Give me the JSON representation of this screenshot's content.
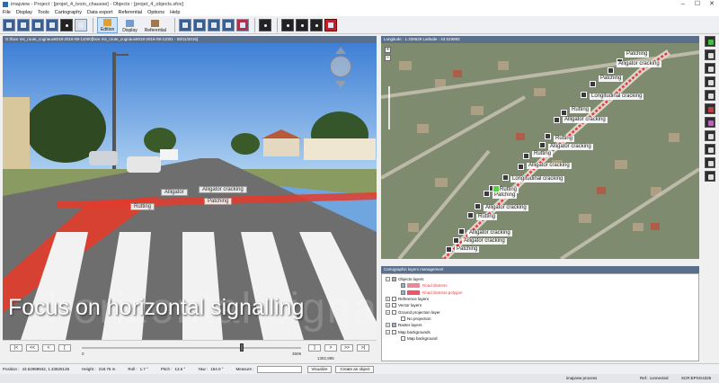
{
  "window": {
    "title": "imajview - Project : [projet_4_tvoin_chausse] - Objects : [projet_4_objects.sfov]",
    "controls": [
      "–",
      "☐",
      "✕"
    ]
  },
  "menu": [
    "File",
    "Display",
    "Tools",
    "Cartography",
    "Data export",
    "Referential",
    "Options",
    "Help"
  ],
  "toolbar": {
    "edition_label": "Edition",
    "display_label": "Display",
    "referential_label": "Referential"
  },
  "video": {
    "header": "G:\\face ms_route_cugnaux6018-2016-08-11000[face ms_route_cugnaux6018-2016-08-11001 - 08/11/2016]",
    "caption": "Focus on horizontal signalling",
    "caption_ghost": "horizontal signalling",
    "labels": {
      "alligator": "Alligator",
      "alligator_cracking": "Alligator cracking",
      "patching": "Patching",
      "rutting": "Rutting"
    }
  },
  "transport": {
    "buttons": [
      "|<",
      "<<",
      "<",
      "[",
      "]",
      ">",
      ">>",
      ">|"
    ],
    "range_start": "0",
    "range_end": "3909",
    "position": 0.73,
    "distance": "1382,886"
  },
  "map": {
    "header": "Longitude : 1.339529 Latitude : 43.529892",
    "tools": [
      "+",
      "−"
    ],
    "labels": [
      "Patching",
      "Alligator cracking",
      "Patching",
      "Longitudinal cracking",
      "Rutting",
      "Alligator cracking",
      "Rutting",
      "Alligator cracking",
      "Rutting",
      "Alligator cracking",
      "Longitudinal cracking",
      "Rutting",
      "Patching",
      "Alligator cracking",
      "Rutting",
      "Alligator cracking",
      "Alligator cracking",
      "Patching"
    ]
  },
  "layers": {
    "header": "Cartographic layers management",
    "rows": [
      {
        "text": "Objects layers",
        "indent": 0,
        "exp": "−",
        "checked": true,
        "red": false
      },
      {
        "text": "Road distress",
        "indent": 1,
        "exp": "",
        "checked": true,
        "red": true,
        "swatch": "#ee8899"
      },
      {
        "text": "Road distress polygon",
        "indent": 1,
        "exp": "",
        "checked": true,
        "red": true,
        "swatch": "#ee5566"
      },
      {
        "text": "Reference layers",
        "indent": 0,
        "exp": "+",
        "checked": false,
        "red": false
      },
      {
        "text": "Vector layers",
        "indent": 0,
        "exp": "+",
        "checked": false,
        "red": false
      },
      {
        "text": "Ground projection layer",
        "indent": 0,
        "exp": "−",
        "checked": false,
        "red": false
      },
      {
        "text": "No projection",
        "indent": 1,
        "exp": "",
        "checked": false,
        "red": false
      },
      {
        "text": "Raster layers",
        "indent": 0,
        "exp": "+",
        "checked": true,
        "red": false
      },
      {
        "text": "Map backgrounds",
        "indent": 0,
        "exp": "−",
        "checked": false,
        "red": false
      },
      {
        "text": "Map background",
        "indent": 1,
        "exp": "",
        "checked": false,
        "red": false
      }
    ]
  },
  "status": {
    "position_label": "Position :",
    "position_value": "43.52989942, 1.33825135",
    "height_label": "Height :",
    "height_value": "218.76 m",
    "roll_label": "Roll :",
    "roll_value": "1.7 °",
    "pitch_label": "Pitch :",
    "pitch_value": "13.6 °",
    "yaw_label": "Yaw :",
    "yaw_value": "154.0 °",
    "measure_label": "Measure :",
    "visualize_label": "Visualize",
    "create_label": "Create an object",
    "process": "imajview process",
    "ref": "Ref.: connected",
    "srs": "SCR:EPSG4326"
  }
}
